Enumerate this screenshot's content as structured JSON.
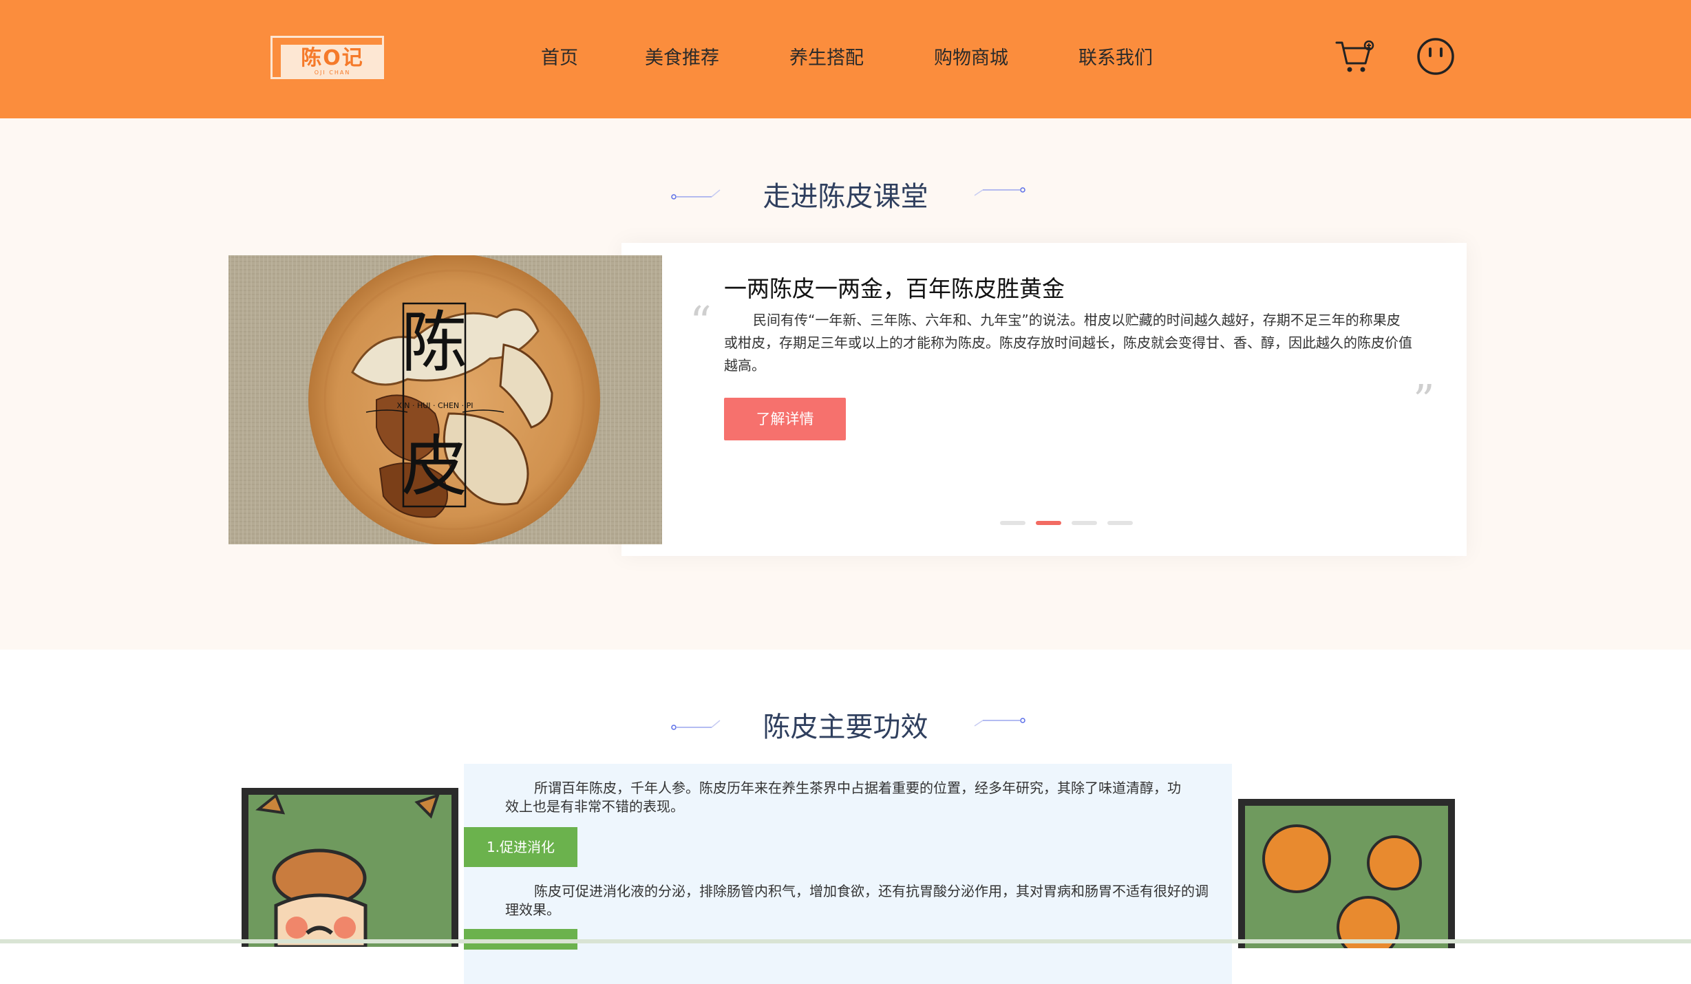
{
  "header": {
    "logo_text": "陈O记",
    "logo_sub": "OJI CHAN",
    "nav": [
      "首页",
      "美食推荐",
      "养生搭配",
      "购物商城",
      "联系我们"
    ]
  },
  "section1": {
    "title": "走进陈皮课堂",
    "image_text_top": "陈",
    "image_text_bottom": "皮",
    "image_caption": "XIN · HUI · CHEN · PI",
    "card_title": "一两陈皮一两金，百年陈皮胜黄金",
    "card_text": "民间有传“一年新、三年陈、六年和、九年宝”的说法。柑皮以贮藏的时间越久越好，存期不足三年的称果皮或柑皮，存期足三年或以上的才能称为陈皮。陈皮存放时间越长，陈皮就会变得甘、香、醇，因此越久的陈皮价值越高。",
    "button_label": "了解详情",
    "carousel_active": 1,
    "carousel_count": 4
  },
  "section2": {
    "title": "陈皮主要功效",
    "intro": "所谓百年陈皮，千年人参。陈皮历年来在养生茶界中占据着重要的位置，经多年研究，其除了味道清醇，功效上也是有非常不错的表现。",
    "item1_label": "1.促进消化",
    "item1_desc": "陈皮可促进消化液的分泌，排除肠管内积气，增加食欲，还有抗胃酸分泌作用，其对胃病和肠胃不适有很好的调理效果。"
  },
  "colors": {
    "header_bg": "#fb8d3d",
    "section1_bg": "#fef8f3",
    "button_bg": "#f6716d",
    "tag_bg": "#6bb24d",
    "title_color": "#2f3f5e"
  }
}
